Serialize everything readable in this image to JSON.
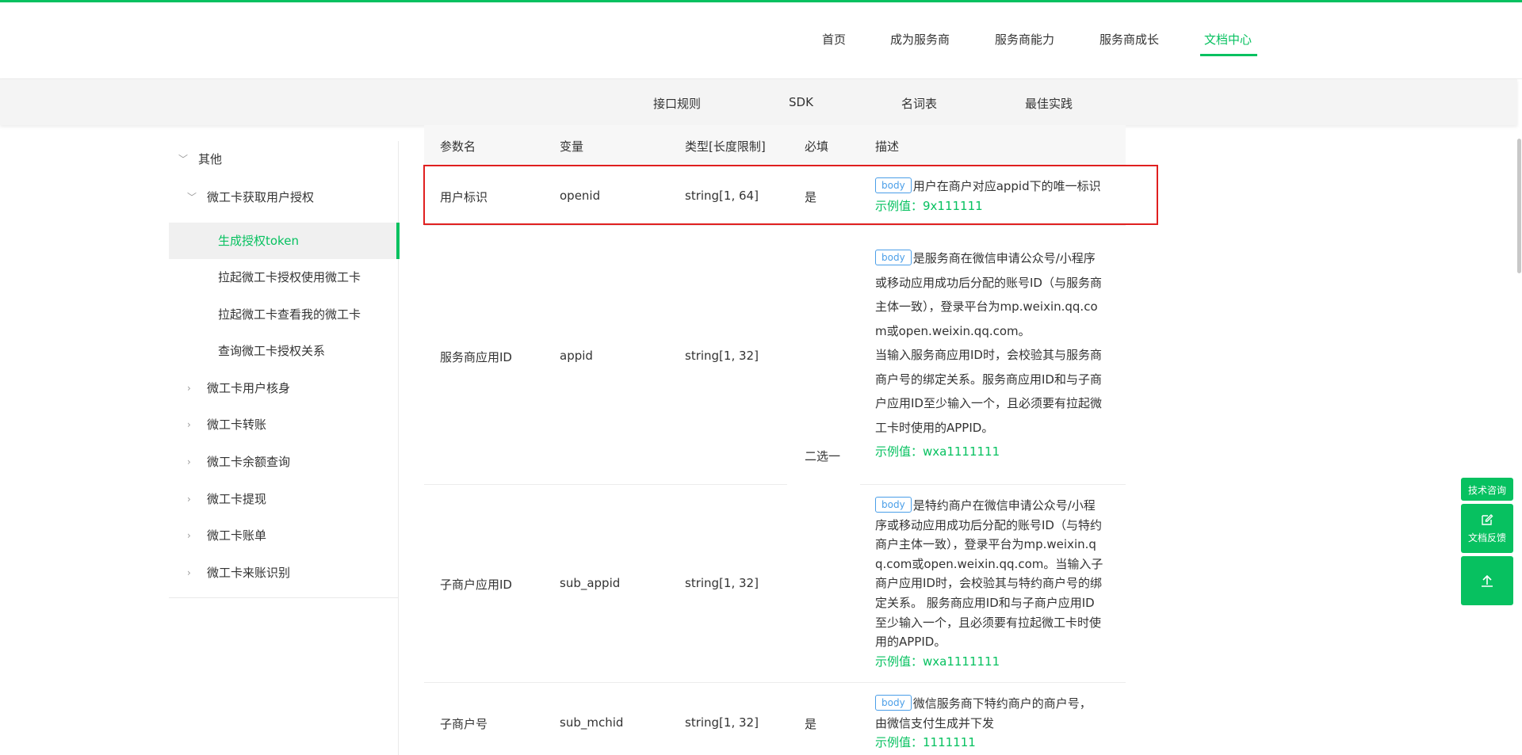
{
  "header": {
    "nav": [
      {
        "label": "首页"
      },
      {
        "label": "成为服务商"
      },
      {
        "label": "服务商能力"
      },
      {
        "label": "服务商成长"
      },
      {
        "label": "文档中心",
        "active": true
      }
    ]
  },
  "subnav": {
    "items": [
      {
        "label": "接口规则"
      },
      {
        "label": "SDK"
      },
      {
        "label": "名词表"
      },
      {
        "label": "最佳实践"
      }
    ]
  },
  "sidebar": {
    "items": [
      {
        "label": "其他",
        "expanded": true
      },
      {
        "label": "微工卡获取用户授权",
        "expanded": true
      },
      {
        "label": "生成授权token",
        "active": true
      },
      {
        "label": "拉起微工卡授权使用微工卡"
      },
      {
        "label": "拉起微工卡查看我的微工卡"
      },
      {
        "label": "查询微工卡授权关系"
      },
      {
        "label": "微工卡用户核身",
        "expanded": false
      },
      {
        "label": "微工卡转账",
        "expanded": false
      },
      {
        "label": "微工卡余额查询",
        "expanded": false
      },
      {
        "label": "微工卡提现",
        "expanded": false
      },
      {
        "label": "微工卡账单",
        "expanded": false
      },
      {
        "label": "微工卡来账识别",
        "expanded": false
      }
    ]
  },
  "table": {
    "headers": [
      "参数名",
      "变量",
      "类型[长度限制]",
      "必填",
      "描述"
    ],
    "tag_label": "body",
    "rows": [
      {
        "name": "用户标识",
        "variable": "openid",
        "type": "string[1, 64]",
        "required": "是",
        "desc": "用户在商户对应appid下的唯一标识",
        "example": "示例值：9x111111"
      },
      {
        "name": "服务商应用ID",
        "variable": "appid",
        "type": "string[1, 32]",
        "required": "二选一",
        "desc_lines": [
          "是服务商在微信申请公众号/小程序",
          "或移动应用成功后分配的账号ID（与服务商",
          "主体一致），登录平台为mp.weixin.qq.co",
          "m或open.weixin.qq.com。",
          "当输入服务商应用ID时，会校验其与服务商",
          "商户号的绑定关系。服务商应用ID和与子商",
          "户应用ID至少输入一个，且必须要有拉起微",
          "工卡时使用的APPID。"
        ],
        "example": "示例值：wxa1111111"
      },
      {
        "name": "子商户应用ID",
        "variable": "sub_appid",
        "type": "string[1, 32]",
        "desc_lines": [
          "是特约商户在微信申请公众号/小程",
          "序或移动应用成功后分配的账号ID（与特约",
          "商户主体一致），登录平台为mp.weixin.q",
          "q.com或open.weixin.qq.com。当输入子",
          "商户应用ID时，会校验其与特约商户号的绑",
          "定关系。 服务商应用ID和与子商户应用ID",
          "至少输入一个，且必须要有拉起微工卡时使",
          "用的APPID。"
        ],
        "example": "示例值：wxa1111111"
      },
      {
        "name": "子商户号",
        "variable": "sub_mchid",
        "type": "string[1, 32]",
        "required": "是",
        "desc_lines": [
          "微信服务商下特约商户的商户号，",
          "由微信支付生成并下发"
        ],
        "example": "示例值：1111111"
      }
    ]
  },
  "float_buttons": {
    "consult": "技术咨询",
    "feedback": "文档反馈",
    "feedback_icon": "edit-icon",
    "top_icon": "arrow-up-icon"
  },
  "colors": {
    "accent": "#07c160",
    "tag": "#4a9ee8",
    "highlight": "#e02020"
  }
}
